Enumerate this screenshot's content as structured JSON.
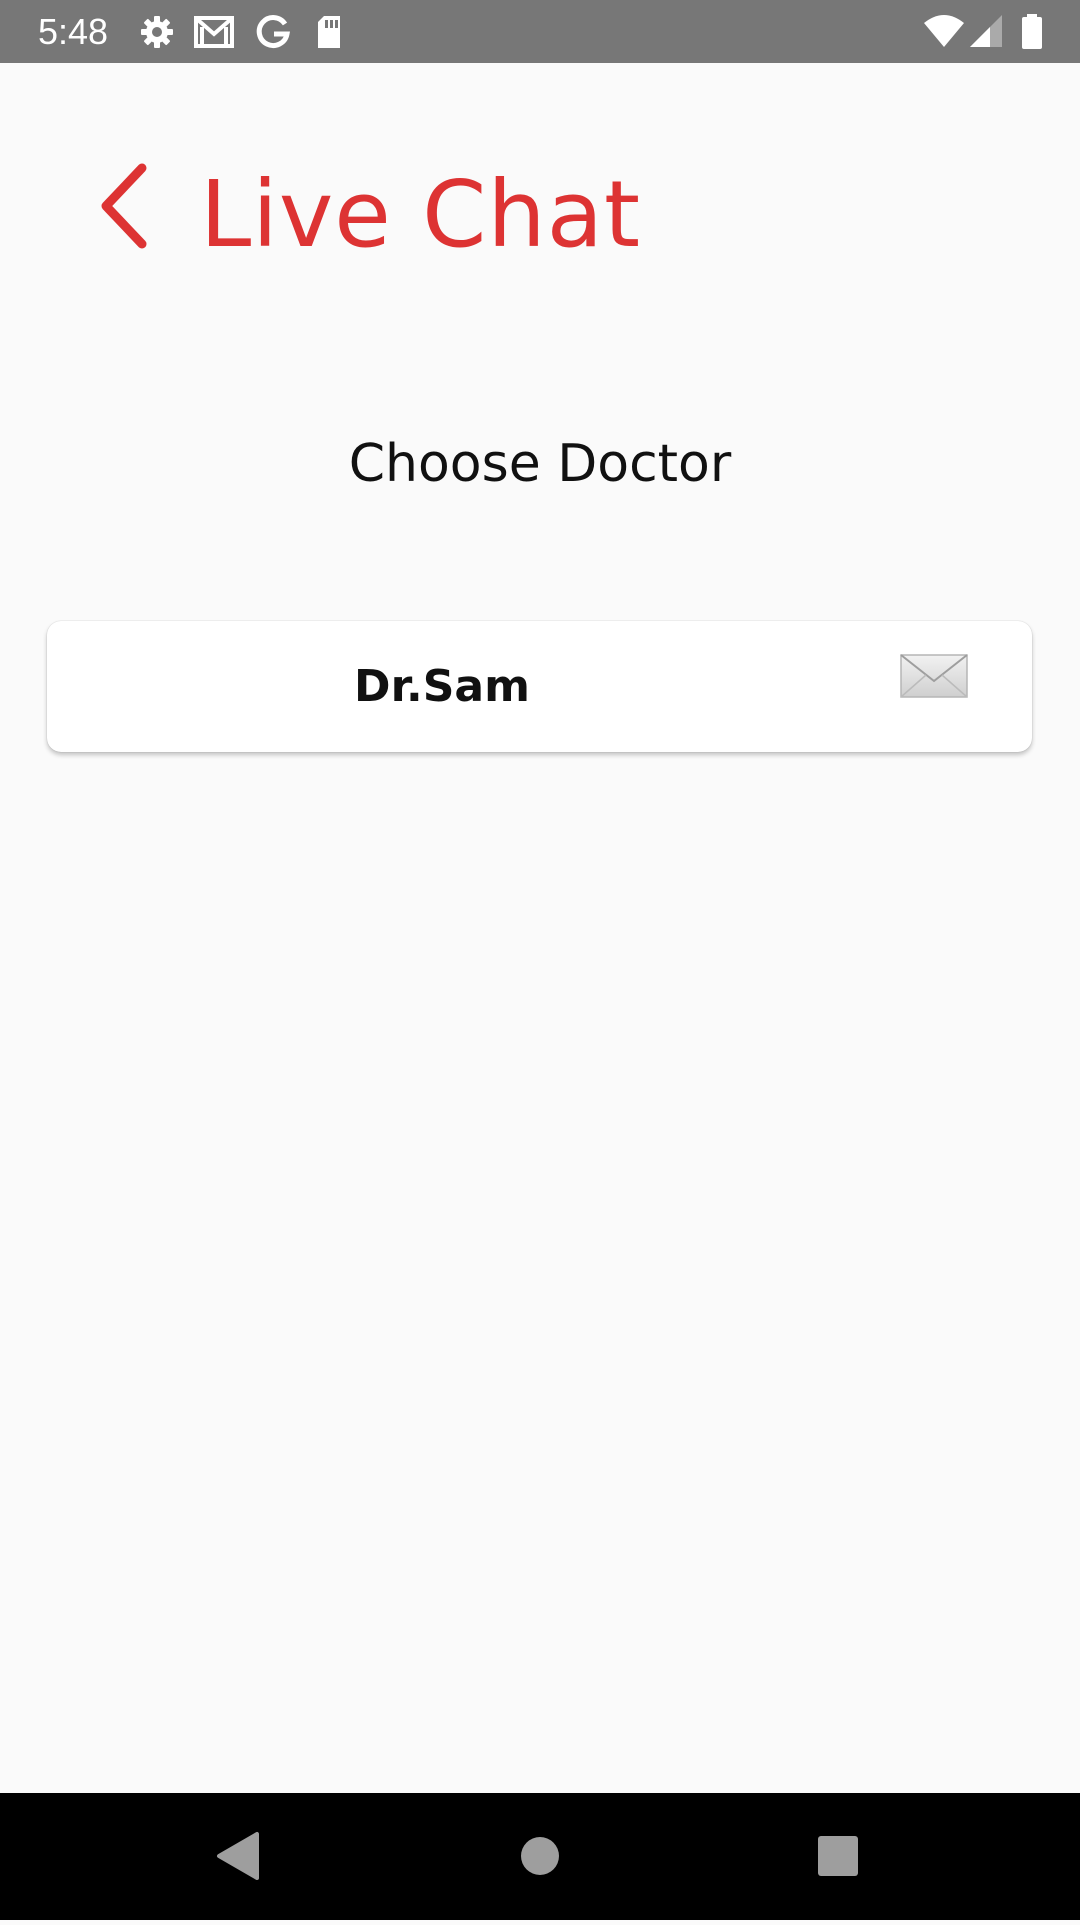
{
  "status_bar": {
    "time": "5:48",
    "left_icons": [
      "settings-icon",
      "gmail-icon",
      "google-icon",
      "sd-card-icon"
    ],
    "right_icons": [
      "wifi-icon",
      "signal-icon",
      "battery-icon"
    ]
  },
  "header": {
    "back_icon": "chevron-left-icon",
    "title": "Live Chat"
  },
  "main": {
    "subtitle": "Choose Doctor",
    "doctors": [
      {
        "name": "Dr.Sam",
        "action_icon": "envelope-icon"
      }
    ]
  },
  "nav_bar": {
    "buttons": [
      "back-triangle-icon",
      "home-circle-icon",
      "recents-square-icon"
    ]
  },
  "colors": {
    "accent": "#dd3333",
    "status_bar": "#777777",
    "background": "#fafafa",
    "nav_bar": "#000000"
  }
}
